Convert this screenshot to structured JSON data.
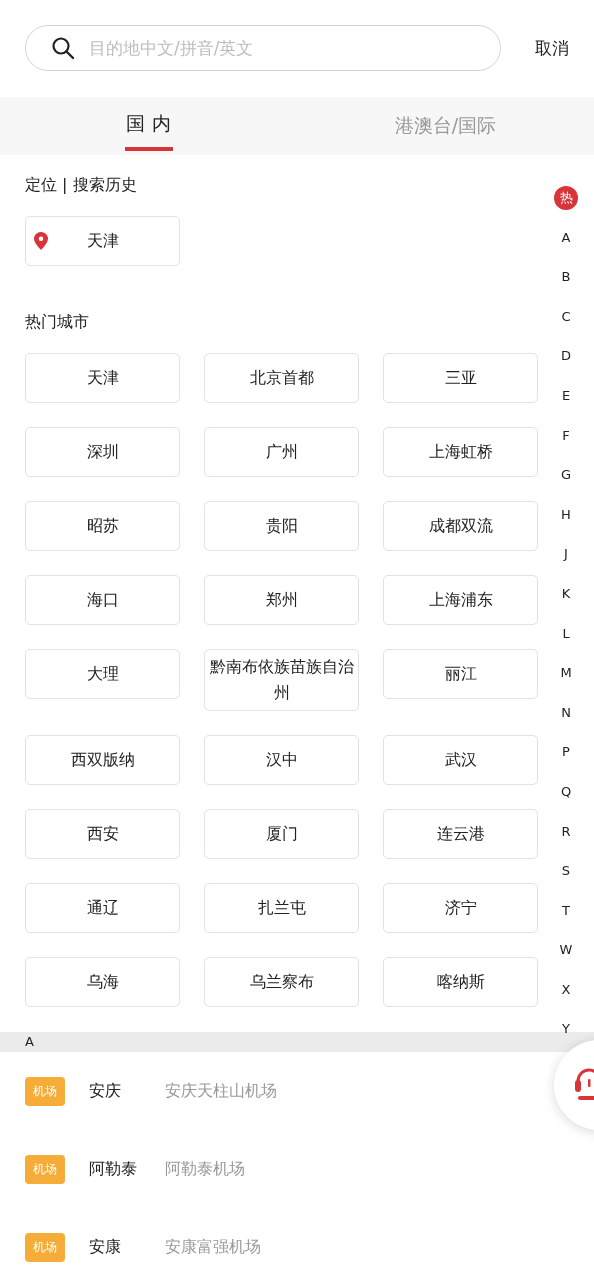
{
  "search": {
    "placeholder": "目的地中文/拼音/英文",
    "cancel": "取消"
  },
  "tabs": [
    {
      "label": "国 内",
      "selected": true
    },
    {
      "label": "港澳台/国际",
      "selected": false
    }
  ],
  "location_section": {
    "title": "定位 | 搜索历史",
    "items": [
      "天津"
    ]
  },
  "hot_section": {
    "title": "热门城市",
    "cities": [
      "天津",
      "北京首都",
      "三亚",
      "深圳",
      "广州",
      "上海虹桥",
      "昭苏",
      "贵阳",
      "成都双流",
      "海口",
      "郑州",
      "上海浦东",
      "大理",
      "黔南布依族苗族自治州",
      "丽江",
      "西双版纳",
      "汉中",
      "武汉",
      "西安",
      "厦门",
      "连云港",
      "通辽",
      "扎兰屯",
      "济宁",
      "乌海",
      "乌兰察布",
      "喀纳斯"
    ]
  },
  "index": [
    {
      "label": "热",
      "selected": true
    },
    {
      "label": "A",
      "selected": false
    },
    {
      "label": "B",
      "selected": false
    },
    {
      "label": "C",
      "selected": false
    },
    {
      "label": "D",
      "selected": false
    },
    {
      "label": "E",
      "selected": false
    },
    {
      "label": "F",
      "selected": false
    },
    {
      "label": "G",
      "selected": false
    },
    {
      "label": "H",
      "selected": false
    },
    {
      "label": "J",
      "selected": false
    },
    {
      "label": "K",
      "selected": false
    },
    {
      "label": "L",
      "selected": false
    },
    {
      "label": "M",
      "selected": false
    },
    {
      "label": "N",
      "selected": false
    },
    {
      "label": "P",
      "selected": false
    },
    {
      "label": "Q",
      "selected": false
    },
    {
      "label": "R",
      "selected": false
    },
    {
      "label": "S",
      "selected": false
    },
    {
      "label": "T",
      "selected": false
    },
    {
      "label": "W",
      "selected": false
    },
    {
      "label": "X",
      "selected": false
    },
    {
      "label": "Y",
      "selected": false
    }
  ],
  "groups": [
    {
      "letter": "A",
      "rows": [
        {
          "tag": "机场",
          "city": "安庆",
          "airport": "安庆天柱山机场"
        },
        {
          "tag": "机场",
          "city": "阿勒泰",
          "airport": "阿勒泰机场"
        },
        {
          "tag": "机场",
          "city": "安康",
          "airport": "安康富强机场"
        }
      ]
    }
  ]
}
